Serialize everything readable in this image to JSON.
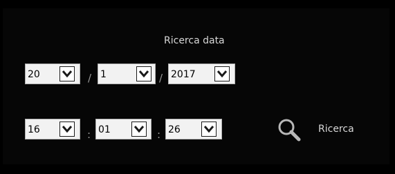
{
  "header": {
    "title": "Ricerca data"
  },
  "date": {
    "day": {
      "value": "20"
    },
    "month": {
      "value": "1"
    },
    "year": {
      "value": "2017"
    },
    "separator": "/"
  },
  "time": {
    "hour": {
      "value": "16"
    },
    "minute": {
      "value": "01"
    },
    "second": {
      "value": "26"
    },
    "separator": ":"
  },
  "search": {
    "label": "Ricerca",
    "icon": "search-icon"
  },
  "colors": {
    "background": "#000000",
    "select_bg": "#f2f2f2",
    "text_light": "#d8d8d8"
  }
}
